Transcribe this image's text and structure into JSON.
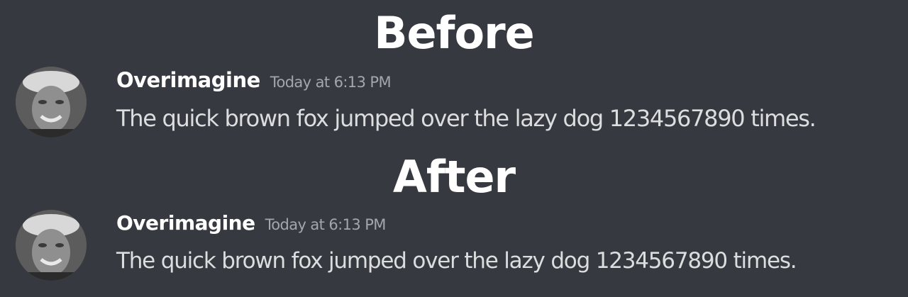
{
  "titles": {
    "before": "Before",
    "after": "After"
  },
  "messages": [
    {
      "username": "Overimagine",
      "timestamp": "Today at 6:13 PM",
      "text": "The quick brown fox jumped over the lazy dog 1234567890 times."
    },
    {
      "username": "Overimagine",
      "timestamp": "Today at 6:13 PM",
      "text": "The quick brown fox jumped over the lazy dog 1234567890 times."
    }
  ],
  "colors": {
    "background": "#36393f",
    "title": "#ffffff",
    "username": "#ffffff",
    "timestamp": "#a3a6aa",
    "message_text": "#dcddde"
  },
  "icons": {
    "avatar": "user-avatar-photo"
  }
}
